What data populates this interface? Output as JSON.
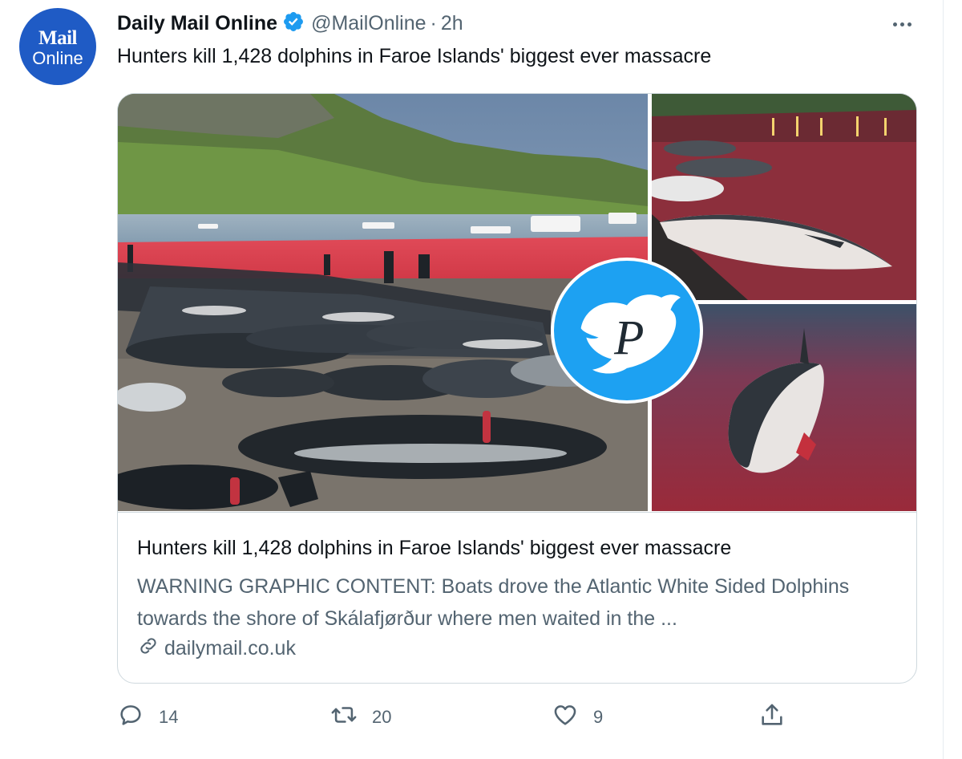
{
  "avatar": {
    "line1": "Mail",
    "line2": "Online"
  },
  "author": {
    "name": "Daily Mail Online",
    "handle": "@MailOnline",
    "separator": "·",
    "time": "2h",
    "verified_icon": "verified-badge-icon"
  },
  "tweet": {
    "text": "Hunters kill 1,428 dolphins in Faroe Islands' biggest ever massacre"
  },
  "card": {
    "title": "Hunters kill 1,428 dolphins in Faroe Islands' biggest ever massacre",
    "description": "WARNING GRAPHIC CONTENT: Boats drove the Atlantic White Sided Dolphins towards the shore of Skálafjørður where men waited in the ...",
    "domain": "dailymail.co.uk",
    "domain_icon": "link-icon",
    "watermark_letter": "P"
  },
  "actions": {
    "reply_count": "14",
    "retweet_count": "20",
    "like_count": "9"
  },
  "colors": {
    "accent": "#1d9bf0",
    "avatar_bg": "#1f5bc5",
    "secondary_text": "#536471",
    "border": "#cfd9de"
  }
}
